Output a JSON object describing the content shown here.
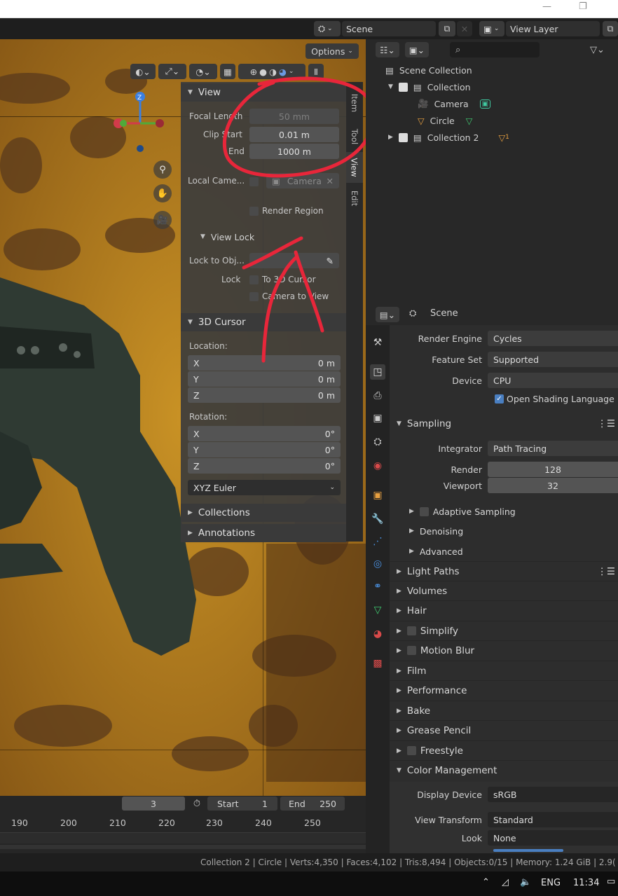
{
  "colors": {
    "accent_blue": "#4a7fc1",
    "annotation_red": "#e8263a",
    "checkbox_checked": "#4a7fc1",
    "rust": "#b8821e"
  },
  "window": {
    "minimize_glyph": "—",
    "restore_glyph": "❐"
  },
  "header": {
    "scene_label": "Scene",
    "view_layer_label": "View Layer",
    "options_label": "Options"
  },
  "npanel": {
    "view_title": "View",
    "focal_length_label": "Focal Length",
    "focal_length_value": "50 mm",
    "clip_start_label": "Clip Start",
    "clip_start_value": "0.01 m",
    "clip_end_label": "End",
    "clip_end_value": "1000 m",
    "local_camera_label": "Local Came...",
    "local_camera_value": "Camera",
    "render_region_label": "Render Region",
    "view_lock_title": "View Lock",
    "lock_to_obj_label": "Lock to Obj...",
    "lock_label": "Lock",
    "to_3d_cursor_label": "To 3D Cursor",
    "camera_to_view_label": "Camera to View",
    "cursor_title": "3D Cursor",
    "location_label": "Location:",
    "location": [
      {
        "axis": "X",
        "value": "0 m"
      },
      {
        "axis": "Y",
        "value": "0 m"
      },
      {
        "axis": "Z",
        "value": "0 m"
      }
    ],
    "rotation_label": "Rotation:",
    "rotation": [
      {
        "axis": "X",
        "value": "0°"
      },
      {
        "axis": "Y",
        "value": "0°"
      },
      {
        "axis": "Z",
        "value": "0°"
      }
    ],
    "rotation_mode": "XYZ Euler",
    "collections_title": "Collections",
    "annotations_title": "Annotations",
    "tabs": [
      "Item",
      "Tool",
      "View",
      "Edit"
    ]
  },
  "outliner": {
    "rows": [
      {
        "label": "Scene Collection"
      },
      {
        "label": "Collection"
      },
      {
        "label": "Camera"
      },
      {
        "label": "Circle"
      },
      {
        "label": "Collection 2",
        "badge": "1"
      }
    ]
  },
  "properties": {
    "header_scene": "Scene",
    "render_engine_label": "Render Engine",
    "render_engine_value": "Cycles",
    "feature_set_label": "Feature Set",
    "feature_set_value": "Supported",
    "device_label": "Device",
    "device_value": "CPU",
    "osl_label": "Open Shading Language",
    "sampling_title": "Sampling",
    "integrator_label": "Integrator",
    "integrator_value": "Path Tracing",
    "render_label": "Render",
    "render_value": "128",
    "viewport_label": "Viewport",
    "viewport_value": "32",
    "adaptive_sampling": "Adaptive Sampling",
    "denoising": "Denoising",
    "advanced": "Advanced",
    "sections": [
      "Light Paths",
      "Volumes",
      "Hair",
      "Simplify",
      "Motion Blur",
      "Film",
      "Performance",
      "Bake",
      "Grease Pencil",
      "Freestyle",
      "Color Management"
    ],
    "display_device_label": "Display Device",
    "display_device_value": "sRGB",
    "view_transform_label": "View Transform",
    "view_transform_value": "Standard",
    "look_label": "Look",
    "look_value": "None"
  },
  "timeline": {
    "current_frame": "3",
    "start_label": "Start",
    "start_value": "1",
    "end_label": "End",
    "end_value": "250",
    "ticks": [
      "190",
      "200",
      "210",
      "220",
      "230",
      "240",
      "250"
    ]
  },
  "status_bar": {
    "text": "Collection 2 | Circle | Verts:4,350 | Faces:4,102 | Tris:8,494 | Objects:0/15 | Memory: 1.24 GiB | 2.9("
  },
  "taskbar": {
    "language": "ENG",
    "time": "11:34"
  }
}
